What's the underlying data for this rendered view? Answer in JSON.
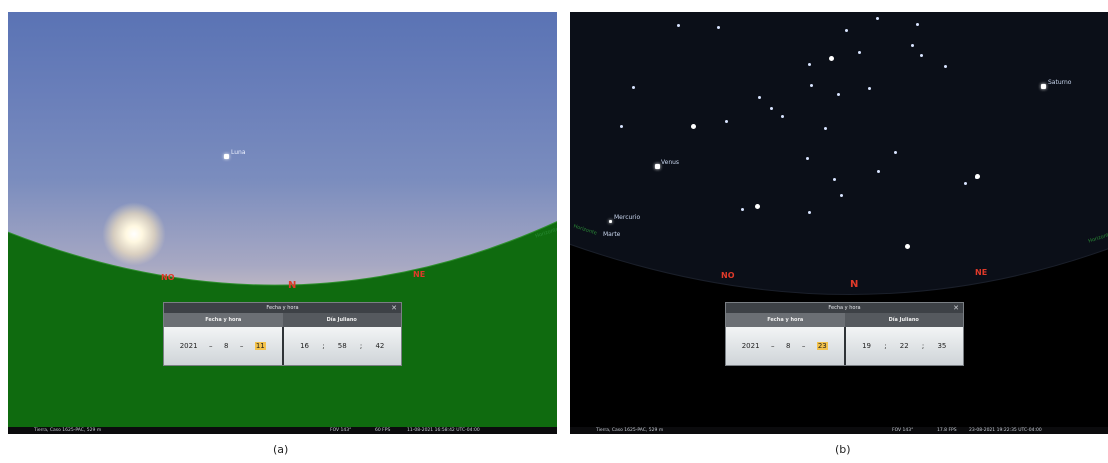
{
  "panel_a": {
    "moon_label": "Luna",
    "cardinals": {
      "nw": "NO",
      "n": "N",
      "ne": "NE"
    },
    "horizon_label": "Horizonte",
    "dialog": {
      "title": "Fecha y hora",
      "tab_date": "Fecha y hora",
      "tab_julian": "Día Juliano",
      "year": "2021",
      "month": "8",
      "day": "11",
      "hour": "16",
      "minute": "58",
      "second": "42",
      "date_sep": "–",
      "time_sep": ";"
    },
    "status": {
      "location": "Tierra, Caso 1625-PAC, 529 m",
      "fov": "FOV 143°",
      "fps": "60 FPS",
      "datetime": "11-08-2021 16:58:42 UTC-04:00"
    },
    "caption": "(a)"
  },
  "panel_b": {
    "labels": {
      "saturn": "Saturno",
      "venus": "Venus",
      "mercury": "Mercurio",
      "mars": "Marte"
    },
    "cardinals": {
      "nw": "NO",
      "n": "N",
      "ne": "NE"
    },
    "horizon_label": "Horizonte",
    "dialog": {
      "title": "Fecha y hora",
      "tab_date": "Fecha y hora",
      "tab_julian": "Día Juliano",
      "year": "2021",
      "month": "8",
      "day": "23",
      "hour": "19",
      "minute": "22",
      "second": "35",
      "date_sep": "–",
      "time_sep": ";"
    },
    "status": {
      "location": "Tierra, Caso 1625-PAC, 529 m",
      "fov": "FOV 143°",
      "fps": "17.8 FPS",
      "datetime": "23-08-2021 19:22:35 UTC-04:00"
    },
    "caption": "(b)"
  },
  "colors": {
    "ground_a": "#0f6b0f",
    "highlight": "#f3c24c",
    "cardinal": "#e03a2a",
    "horizon": "#2a8a36"
  }
}
